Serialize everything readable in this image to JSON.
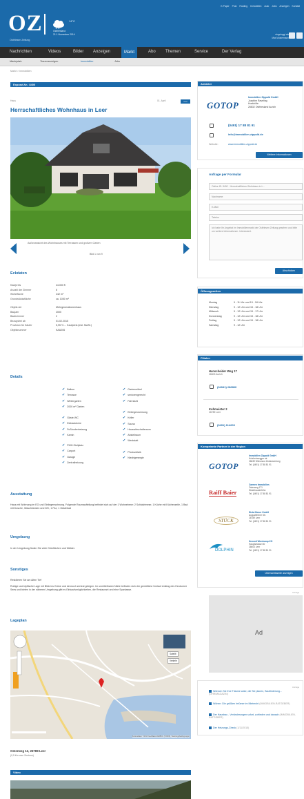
{
  "header": {
    "top_links": [
      "E-Paper",
      "Post",
      "Routing",
      "Immobilien",
      "Auto",
      "Jobs",
      "Anzeigen",
      "Kontakt"
    ],
    "logo": "OZ",
    "logo_sub": "Ostfriesen Zeitung",
    "weather_temp": "14°C",
    "weather_place": "Ostfriesland",
    "weather_date": "21.1 November 2014",
    "user_name": "Max Mustermann",
    "user_note": "eingeloggt als"
  },
  "nav": {
    "items": [
      "Nachrichten",
      "Videos",
      "Bilder",
      "Anzeigen",
      "Markt",
      "Abo",
      "Themen",
      "Service",
      "Der Verlag"
    ],
    "active": "Markt"
  },
  "subnav": {
    "items": [
      "Marktplatz",
      "Traueranzeigen",
      "Immobilien",
      "Jobs"
    ],
    "active": "Immobilien"
  },
  "breadcrumb": "Markt > Immobilien",
  "listing": {
    "expose_bar": "Exposé-Nr.: 8400",
    "kind": "Haus",
    "date": "01. April",
    "badge": "neu",
    "title": "Herrschaftliches Wohnhaus in Leer",
    "caption": "Außenansicht des Wohnhauses mit Terrassen und großem Garten",
    "pager": "Bild 1 von 9"
  },
  "eckdaten": {
    "heading": "Eckdaten",
    "rows1": [
      {
        "k": "Kaufpreis",
        "v": "44.000 €"
      },
      {
        "k": "Anzahl der Zimmer",
        "v": "6"
      },
      {
        "k": "Wohnfläche",
        "v": "242 m²"
      },
      {
        "k": "Grundstücksfläche",
        "v": "ca. 1050 m²"
      }
    ],
    "rows2": [
      {
        "k": "Objekt-Art",
        "v": "Mehrgenerationenhaus"
      },
      {
        "k": "Baujahr",
        "v": "2000"
      },
      {
        "k": "Badezimmer",
        "v": "2"
      },
      {
        "k": "Bezugsfrei ab",
        "v": "01.02.2015"
      },
      {
        "k": "Provision für Käufer",
        "v": "5,95 % ... Kaufpreis (inkl. MwSt.)"
      },
      {
        "k": "Objektnummer",
        "v": "KAA206"
      }
    ]
  },
  "details": {
    "heading": "Details",
    "col1": [
      [
        "Balkon",
        "Terrasse",
        "Wintergarten",
        "2000 m² Garten"
      ],
      [
        "Gäste-WC",
        "Einbauküche",
        "Fußbodenheizung",
        "Kamin"
      ],
      [
        "PKW-Stellplatz",
        "Carport",
        "Garage",
        "Zentralheizung"
      ]
    ],
    "col2": [
      [
        "Gartenmöbel",
        "seniorengerecht",
        "Fahrstuhl"
      ],
      [
        "Einliegerwohnung",
        "Keller",
        "Sauna",
        "Hauswirtschaftsraum",
        "Abstellraum",
        "Werkstatt"
      ],
      [
        "Photovoltaik",
        "Niedrigenergie"
      ]
    ]
  },
  "ausstattung": {
    "heading": "Ausstattung",
    "text": "Haus mit Wohnung im EG und Einliegerwohnung. Folgende Raumaufteilung befindet sich auf der 1 Wohnebene: 2 Schlafzimmer, 1 Küche mit Küchenzeile, 1 Bad mit Dusche, Waschbecken und WC, 1 Flur, 1 Gästebad"
  },
  "umgebung": {
    "heading": "Umgebung",
    "text": "In der Umgebung finden Sie viele Grünflächen und Wälder."
  },
  "sonstiges": {
    "heading": "Sonstiges",
    "line1": "Residieren Sie am Alten Tief",
    "text": "Ruhige und idyllische Lage mit Blick ins Grüne und dennoch zentral gelegen. Im unmittelbaren Nähe befinden sich der gemütliche Umlauf entlang des Heukumer Sees und bieten in der näheren Umgebung gibt es Einkaufsmöglichkeiten, die Restaurant und eine Sparkasse."
  },
  "lageplan": {
    "heading": "Lageplan",
    "map_sat": "Satellit",
    "map_traffic": "Verkehr",
    "attribution": "Kartendaten ©2013 GeoBasis-DE/BKG (©2009), Google",
    "terms": "Nutzungsbedingungen",
    "address": "Osterweg 12, 26789 Leer",
    "distance": "(0,5 Km vom Zentrum)"
  },
  "video": {
    "heading": "Video"
  },
  "anbieter": {
    "heading": "Anbieter",
    "logo": "GOTOP",
    "company": "Immobilien Zippold GmbH",
    "contact_lines": [
      "Joachim Raveling",
      "Hoekhöfe",
      "26832 Ostfriesland Aurich"
    ],
    "phone": "(0491) 17 88 81 91",
    "email": "info@immobilien-zippold.de",
    "web_label": "Website:",
    "web": "www.immobilien-zippold.de",
    "more_button": "Weitere Informationen"
  },
  "anfrage": {
    "heading": "Anfrage per Formular",
    "fields": [
      "Online ID: 8400 · Herrschaftliches Wohnhaus in L...",
      "Nachname",
      "E-Mail",
      "Telefon"
    ],
    "message": "Ich habe Ihr Angebot im Immobilienmarkt der Ostfriesen Zeitung gesehen und bitte um weitere Informationen. Interessiert.",
    "submit": "Abschicken"
  },
  "oeffnungszeiten": {
    "heading": "Öffnungszeiten",
    "rows": [
      {
        "d": "Montag",
        "t": "9 - 11 Uhr und 15 - 18 Uhr"
      },
      {
        "d": "Dienstag",
        "t": "9 - 12 Uhr und 15 - 18 Uhr"
      },
      {
        "d": "Mittwoch",
        "t": "9 - 12 Uhr und 15 - 17 Uhr"
      },
      {
        "d": "Donnerstag",
        "t": "9 - 12 Uhr und 15 - 18 Uhr"
      },
      {
        "d": "Freitag",
        "t": "9 - 12 Uhr und 15 - 18 Uhr"
      },
      {
        "d": "Samstag",
        "t": "9 - 12 Uhr"
      }
    ]
  },
  "filialen": {
    "heading": "Filialen",
    "f1_street": "Hanscheider Weg 17",
    "f1_city": "26603 Aurich",
    "f1_phone": "(04941) 286800",
    "f2_street": "Kuhmeister 2",
    "f2_city": "26789 Leer",
    "f2_phone": "(0491) 114200"
  },
  "partner": {
    "heading": "Kompetente Partner in der Region",
    "items": [
      {
        "logo": "GOTOP",
        "name": "Immobilien Zippold GmbH",
        "l1": "Holzheinsegger str.",
        "l2": "26639 Wiesmoor Ahrlansenborg",
        "tel": "Tel. (0491) 17 88 81 91"
      },
      {
        "logo": "Raiff Baier",
        "name": "Carmen Immobilien",
        "l1": "Osterweg 171",
        "l2": "Westrhauderfehn",
        "tel": "Tel. (0491) 17 88 81 91"
      },
      {
        "logo": "STÜCK",
        "name": "Dieta Nieser GmbH",
        "l1": "Augustfehner Str.",
        "l2": "26789 Leer",
        "tel": "Tel. (0491) 17 88 81 91"
      },
      {
        "logo": "DOLPHIN",
        "name": "Hemmit Weerkamp KG",
        "l1": "Hauptstrasse 80",
        "l2": "26603 Leer",
        "tel": "Tel. (0491) 17 88 81 91"
      }
    ],
    "button": "Übersichtsseite anzeigen"
  },
  "ad": {
    "label": "Anzeige",
    "text": "Ad"
  },
  "news": {
    "label": "Anzeige",
    "items": [
      {
        "t": "Wohnen Sie Ihre Träume wahr, die Sie planen, Bauförderung...",
        "g": "(OHR/MAGAZIN)"
      },
      {
        "t": "Wohen: Die größten Irrtümer im Mietrecht",
        "g": "(IMMOBILIEN-RATGEBER)"
      },
      {
        "t": "Der Hausbau - Veränderungen sofort, zufrieden und danach",
        "g": "(IMMOBILIEN-RATGEBER)"
      },
      {
        "t": "Der Heizungs-Check",
        "g": "(1/11/2015)"
      }
    ]
  }
}
